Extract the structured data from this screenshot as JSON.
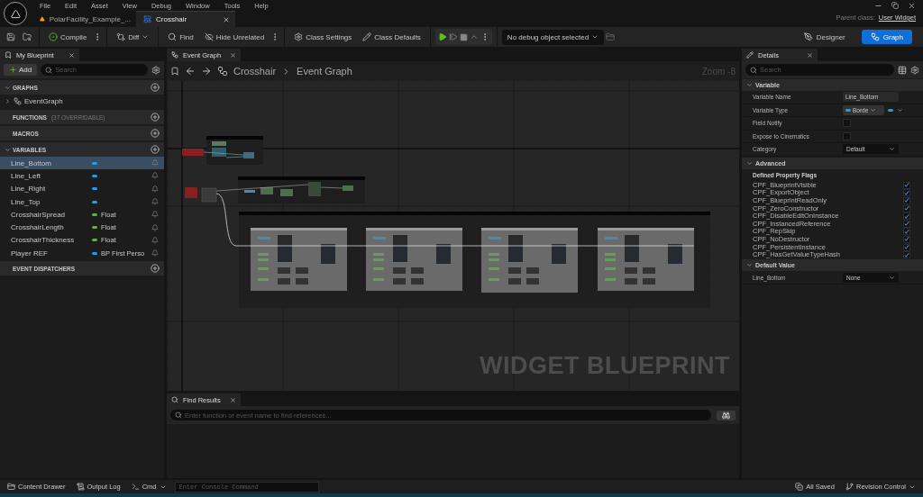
{
  "menu": [
    "File",
    "Edit",
    "Asset",
    "View",
    "Debug",
    "Window",
    "Tools",
    "Help"
  ],
  "doc_tabs": [
    {
      "label": "PolarFacility_Example_...",
      "kind": "level",
      "selected": false
    },
    {
      "label": "Crosshair",
      "kind": "widget",
      "selected": true
    }
  ],
  "parent_class": {
    "label": "Parent class:",
    "value": "User Widget"
  },
  "toolbar": [
    {
      "label": "Compile",
      "kind": "compile"
    },
    {
      "label": "Diff",
      "kind": "diff"
    },
    {
      "label": "Find",
      "kind": "find"
    },
    {
      "label": "Hide Unrelated",
      "kind": "hide"
    },
    {
      "label": "Class Settings",
      "kind": "settings"
    },
    {
      "label": "Class Defaults",
      "kind": "defaults"
    }
  ],
  "debug_dropdown": "No debug object selected",
  "mode_buttons": [
    {
      "label": "Designer",
      "kind": "designer",
      "selected": false
    },
    {
      "label": "Graph",
      "kind": "graph",
      "selected": true
    }
  ],
  "my_blueprint": {
    "tab": "My Blueprint",
    "add_label": "Add",
    "search_placeholder": "Search",
    "sections": [
      {
        "title": "GRAPHS",
        "expanded": true,
        "graphs": [
          "EventGraph"
        ]
      },
      {
        "title": "FUNCTIONS",
        "note": "(37 OVERRIDABLE)",
        "expanded": false
      },
      {
        "title": "MACROS",
        "expanded": false
      },
      {
        "title": "VARIABLES",
        "expanded": true,
        "variables": [
          {
            "name": "Line_Bottom",
            "color": "#1aa3e0",
            "selected": true
          },
          {
            "name": "Line_Left",
            "color": "#1aa3e0",
            "selected": false
          },
          {
            "name": "Line_Right",
            "color": "#1aa3e0",
            "selected": false
          },
          {
            "name": "Line_Top",
            "color": "#1aa3e0",
            "selected": false
          },
          {
            "name": "CrosshairSpread",
            "type": "Float",
            "color": "#4fc21a",
            "selected": false
          },
          {
            "name": "CrosshairLength",
            "type": "Float",
            "color": "#4fc21a",
            "selected": false
          },
          {
            "name": "CrosshairThickness",
            "type": "Float",
            "color": "#4fc21a",
            "selected": false
          },
          {
            "name": "Player REF",
            "type": "BP First Perso",
            "color": "#1aa3e0",
            "selected": false
          }
        ]
      },
      {
        "title": "EVENT DISPATCHERS",
        "expanded": false
      }
    ]
  },
  "graph": {
    "tab": "Event Graph",
    "breadcrumb": [
      "Crosshair",
      "Event Graph"
    ],
    "zoom": "Zoom -8",
    "watermark": "WIDGET BLUEPRINT"
  },
  "find_results": {
    "tab": "Find Results",
    "placeholder": "Enter function or event name to find references..."
  },
  "details": {
    "tab": "Details",
    "search_placeholder": "Search",
    "sections": [
      {
        "title": "Variable",
        "expanded": true,
        "rows": [
          {
            "label": "Variable Name",
            "kind": "text",
            "value": "Line_Bottom"
          },
          {
            "label": "Variable Type",
            "kind": "type",
            "value": "Borde"
          },
          {
            "label": "Field Notify",
            "kind": "checkbox",
            "checked": false
          },
          {
            "label": "Expose to Cinematics",
            "kind": "checkbox",
            "checked": false
          },
          {
            "label": "Category",
            "kind": "select",
            "value": "Default"
          }
        ]
      },
      {
        "title": "Advanced",
        "expanded": true,
        "heading": "Defined Property Flags",
        "flags": [
          {
            "label": "CPF_BlueprintVisible",
            "checked": true
          },
          {
            "label": "CPF_ExportObject",
            "checked": true
          },
          {
            "label": "CPF_BlueprintReadOnly",
            "checked": true
          },
          {
            "label": "CPF_ZeroConstructor",
            "checked": true
          },
          {
            "label": "CPF_DisableEditOnInstance",
            "checked": true
          },
          {
            "label": "CPF_InstancedReference",
            "checked": true
          },
          {
            "label": "CPF_RepSkip",
            "checked": true
          },
          {
            "label": "CPF_NoDestructor",
            "checked": true
          },
          {
            "label": "CPF_PersistentInstance",
            "checked": true
          },
          {
            "label": "CPF_HasGetValueTypeHash",
            "checked": true
          }
        ]
      },
      {
        "title": "Default Value",
        "expanded": true,
        "rows": [
          {
            "label": "Line_Bottom",
            "kind": "select",
            "value": "None"
          }
        ]
      }
    ]
  },
  "status_bar": {
    "left": [
      {
        "label": "Content Drawer",
        "kind": "drawer"
      },
      {
        "label": "Output Log",
        "kind": "log"
      },
      {
        "label": "Cmd",
        "kind": "cmd"
      }
    ],
    "console_placeholder": "Enter Console Command",
    "right": [
      {
        "label": "All Saved",
        "kind": "saved"
      },
      {
        "label": "Revision Control",
        "kind": "revision"
      }
    ]
  }
}
